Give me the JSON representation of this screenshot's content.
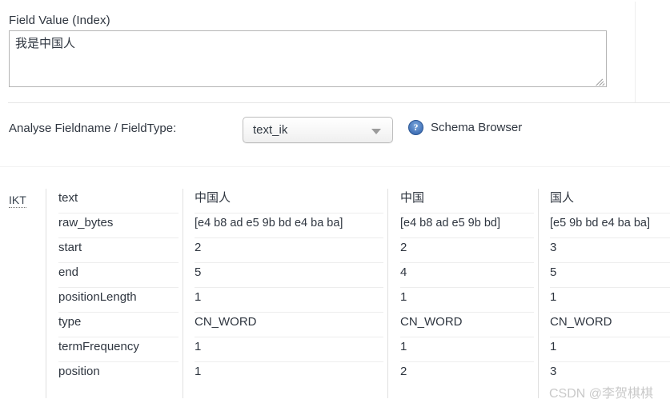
{
  "field_value_section": {
    "label": "Field Value (Index)",
    "textarea_value": "我是中国人"
  },
  "analyse_row": {
    "label": "Analyse Fieldname / FieldType:",
    "fieldtype_selected": "text_ik",
    "help_icon_glyph": "?",
    "schema_browser_label": "Schema Browser"
  },
  "analysis_table": {
    "analyzer_tag": "IKT",
    "row_labels": [
      "text",
      "raw_bytes",
      "start",
      "end",
      "positionLength",
      "type",
      "termFrequency",
      "position"
    ],
    "tokens": [
      {
        "text": "中国人",
        "raw_bytes": "[e4 b8 ad e5 9b bd e4 ba ba]",
        "start": "2",
        "end": "5",
        "positionLength": "1",
        "type": "CN_WORD",
        "termFrequency": "1",
        "position": "1"
      },
      {
        "text": "中国",
        "raw_bytes": "[e4 b8 ad e5 9b bd]",
        "start": "2",
        "end": "4",
        "positionLength": "1",
        "type": "CN_WORD",
        "termFrequency": "1",
        "position": "2"
      },
      {
        "text": "国人",
        "raw_bytes": "[e5 9b bd e4 ba ba]",
        "start": "3",
        "end": "5",
        "positionLength": "1",
        "type": "CN_WORD",
        "termFrequency": "1",
        "position": "3"
      }
    ]
  },
  "watermark": "CSDN @李贺棋棋",
  "colors": {
    "text": "#2f3640",
    "border": "#b4b4b4",
    "divider": "#ededed",
    "help_icon": "#3f6fb5",
    "watermark": "#c9c9c9"
  }
}
